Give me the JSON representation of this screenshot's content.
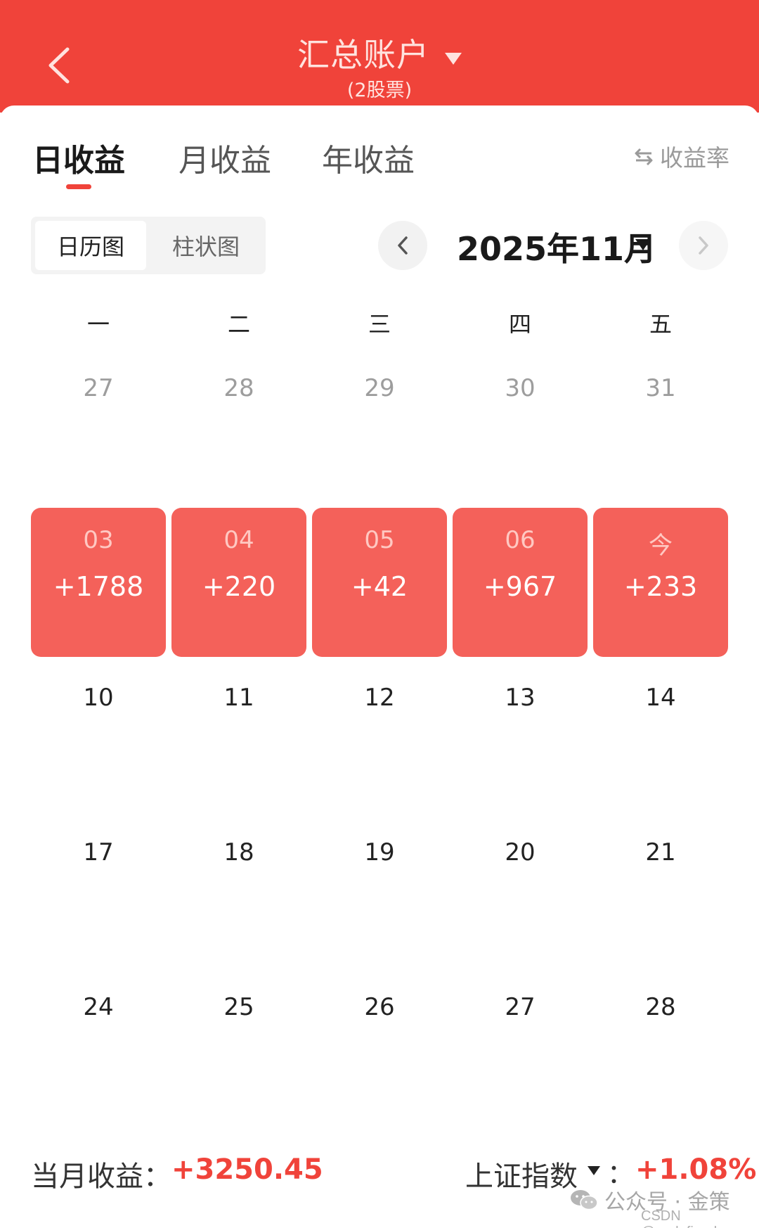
{
  "header": {
    "title": "汇总账户",
    "subtitle": "(2股票)",
    "bg_color": "#f0433a"
  },
  "tabs": [
    {
      "label": "日收益",
      "active": true
    },
    {
      "label": "月收益",
      "active": false
    },
    {
      "label": "年收益",
      "active": false
    }
  ],
  "rate_toggle": {
    "label": "收益率",
    "icon": "swap-arrows-icon"
  },
  "view_toggle": {
    "calendar": "日历图",
    "bar": "柱状图",
    "selected": "日历图"
  },
  "month_nav": {
    "label": "2025年11月"
  },
  "calendar": {
    "weekdays": [
      "一",
      "二",
      "三",
      "四",
      "五"
    ],
    "week1": [
      "27",
      "28",
      "29",
      "30",
      "31"
    ],
    "week2": [
      {
        "date": "03",
        "value": "+1788"
      },
      {
        "date": "04",
        "value": "+220"
      },
      {
        "date": "05",
        "value": "+42"
      },
      {
        "date": "06",
        "value": "+967"
      },
      {
        "date": "今",
        "value": "+233"
      }
    ],
    "week3": [
      "10",
      "11",
      "12",
      "13",
      "14"
    ],
    "week4": [
      "17",
      "18",
      "19",
      "20",
      "21"
    ],
    "week5": [
      "24",
      "25",
      "26",
      "27",
      "28"
    ],
    "gain_color": "#f4615a"
  },
  "footer": {
    "month_label": "当月收益：",
    "month_value": "+3250.45",
    "index_label": "上证指数",
    "index_colon": "：",
    "index_value": "+1.08%"
  },
  "watermark": {
    "text": "公众号 · 金策",
    "csdn": "CSDN @undefined"
  }
}
